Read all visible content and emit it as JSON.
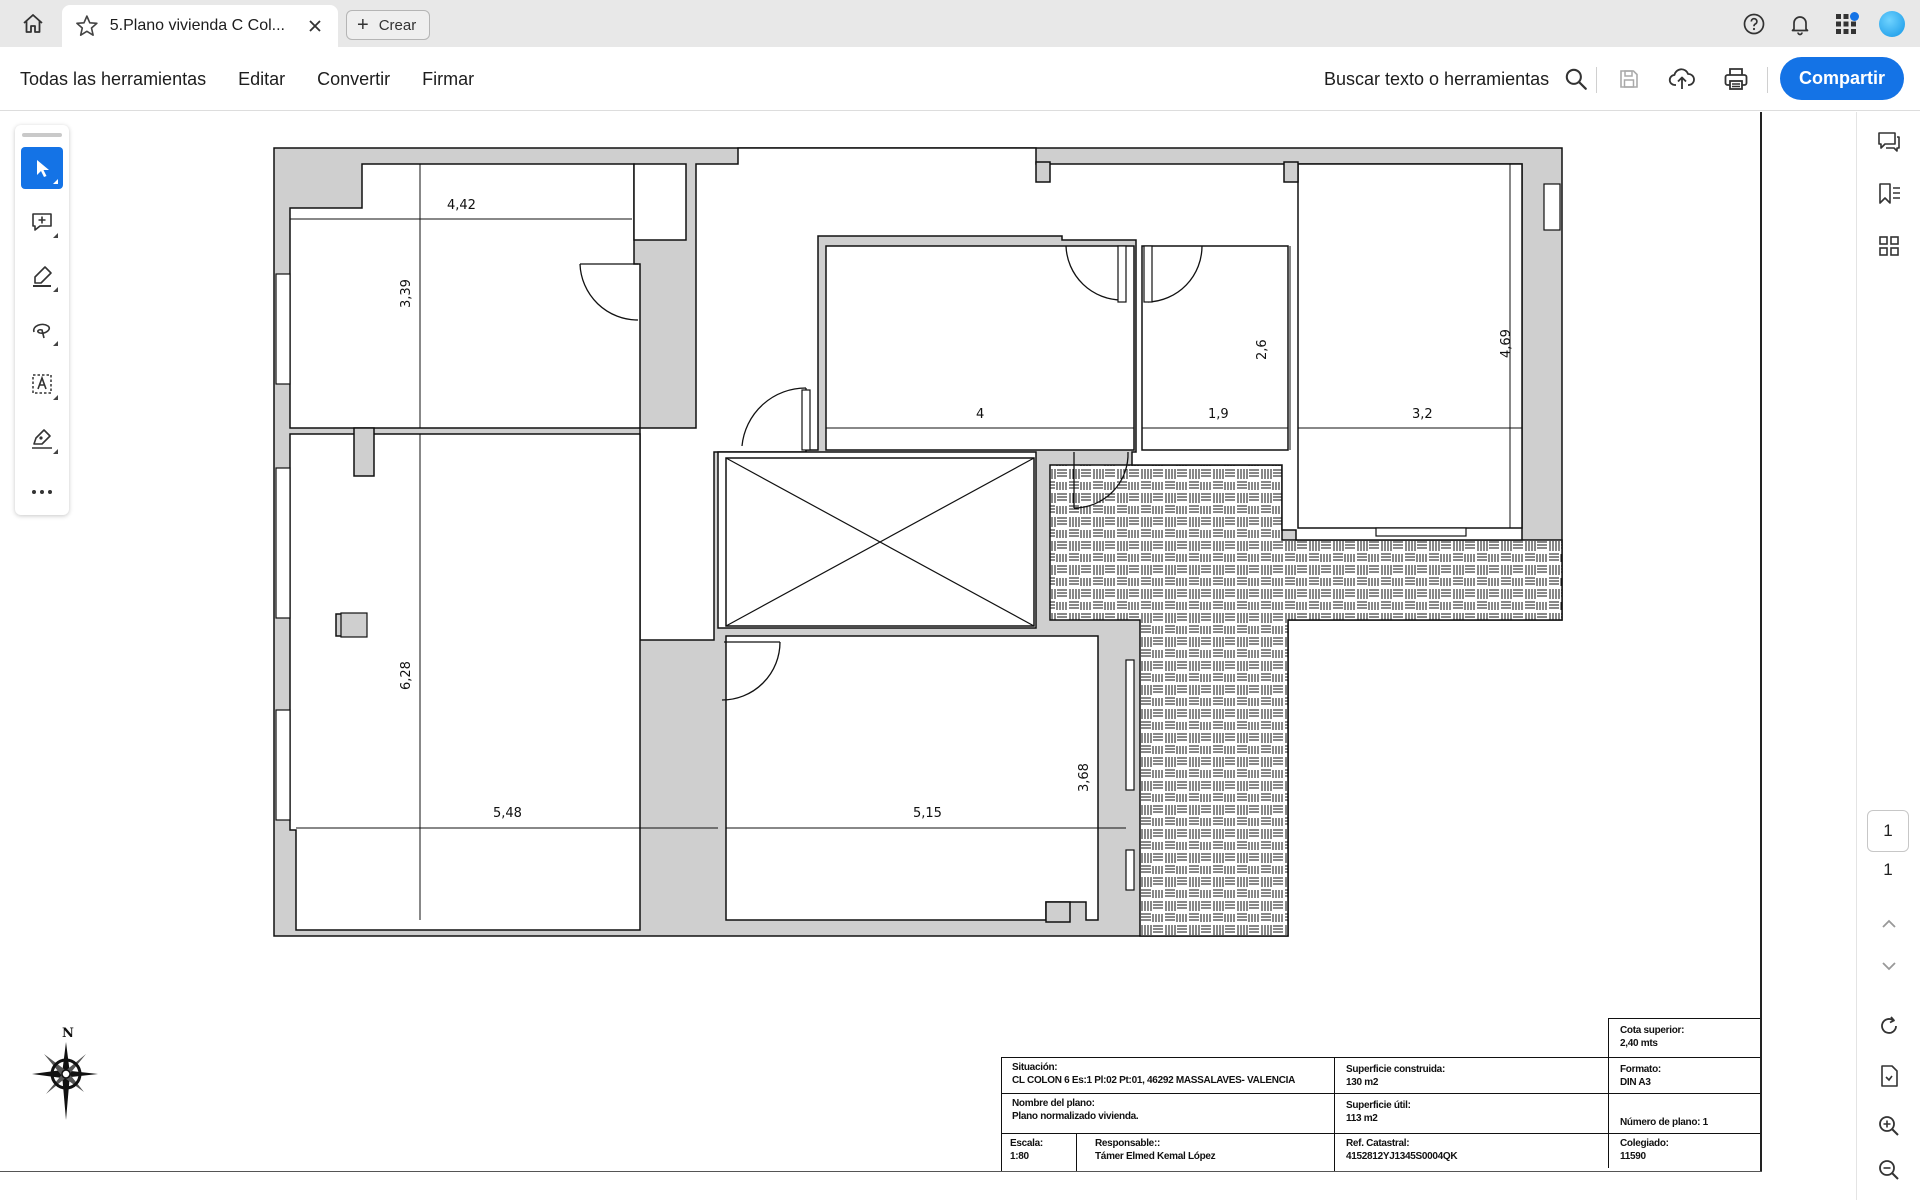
{
  "tabbar": {
    "tab_title": "5.Plano vivienda C Col...",
    "new_tab_label": "Crear"
  },
  "toolbar": {
    "menu": [
      "Todas las herramientas",
      "Editar",
      "Convertir",
      "Firmar"
    ],
    "search_label": "Buscar texto o herramientas",
    "share_label": "Compartir"
  },
  "tools": [
    "select-tool",
    "comment-tool",
    "highlight-tool",
    "draw-tool",
    "text-select-tool",
    "sign-tool",
    "more-tools"
  ],
  "plan": {
    "dims": {
      "d442": "4,42",
      "d339": "3,39",
      "d4": "4",
      "d19": "1,9",
      "d26": "2,6",
      "d32": "3,2",
      "d469": "4,69",
      "d628": "6,28",
      "d548": "5,48",
      "d515": "5,15",
      "d368": "3,68"
    },
    "compass_label": "N"
  },
  "title_block": {
    "cota_label": "Cota superior:",
    "cota_value": "2,40 mts",
    "situacion_label": "Situación:",
    "situacion_value": "CL COLON 6 Es:1 Pl:02 Pt:01, 46292 MASSALAVES- VALENCIA",
    "sup_construida_label": "Superficie construida:",
    "sup_construida_value": "130 m2",
    "formato_label": "Formato:",
    "formato_value": "DIN A3",
    "nombre_label": "Nombre del plano:",
    "nombre_value": "Plano normalizado vivienda.",
    "sup_util_label": "Superficie útil:",
    "sup_util_value": "113 m2",
    "numero_plano": "Número de plano: 1",
    "escala_label": "Escala:",
    "escala_value": "1:80",
    "responsable_label": "Responsable::",
    "responsable_value": "Támer Elmed Kemal López",
    "ref_label": "Ref. Catastral:",
    "ref_value": "4152812YJ1345S0004QK",
    "colegiado_label": "Colegiado:",
    "colegiado_value": "11590"
  },
  "pagination": {
    "current_page": "1",
    "total_pages": "1"
  }
}
